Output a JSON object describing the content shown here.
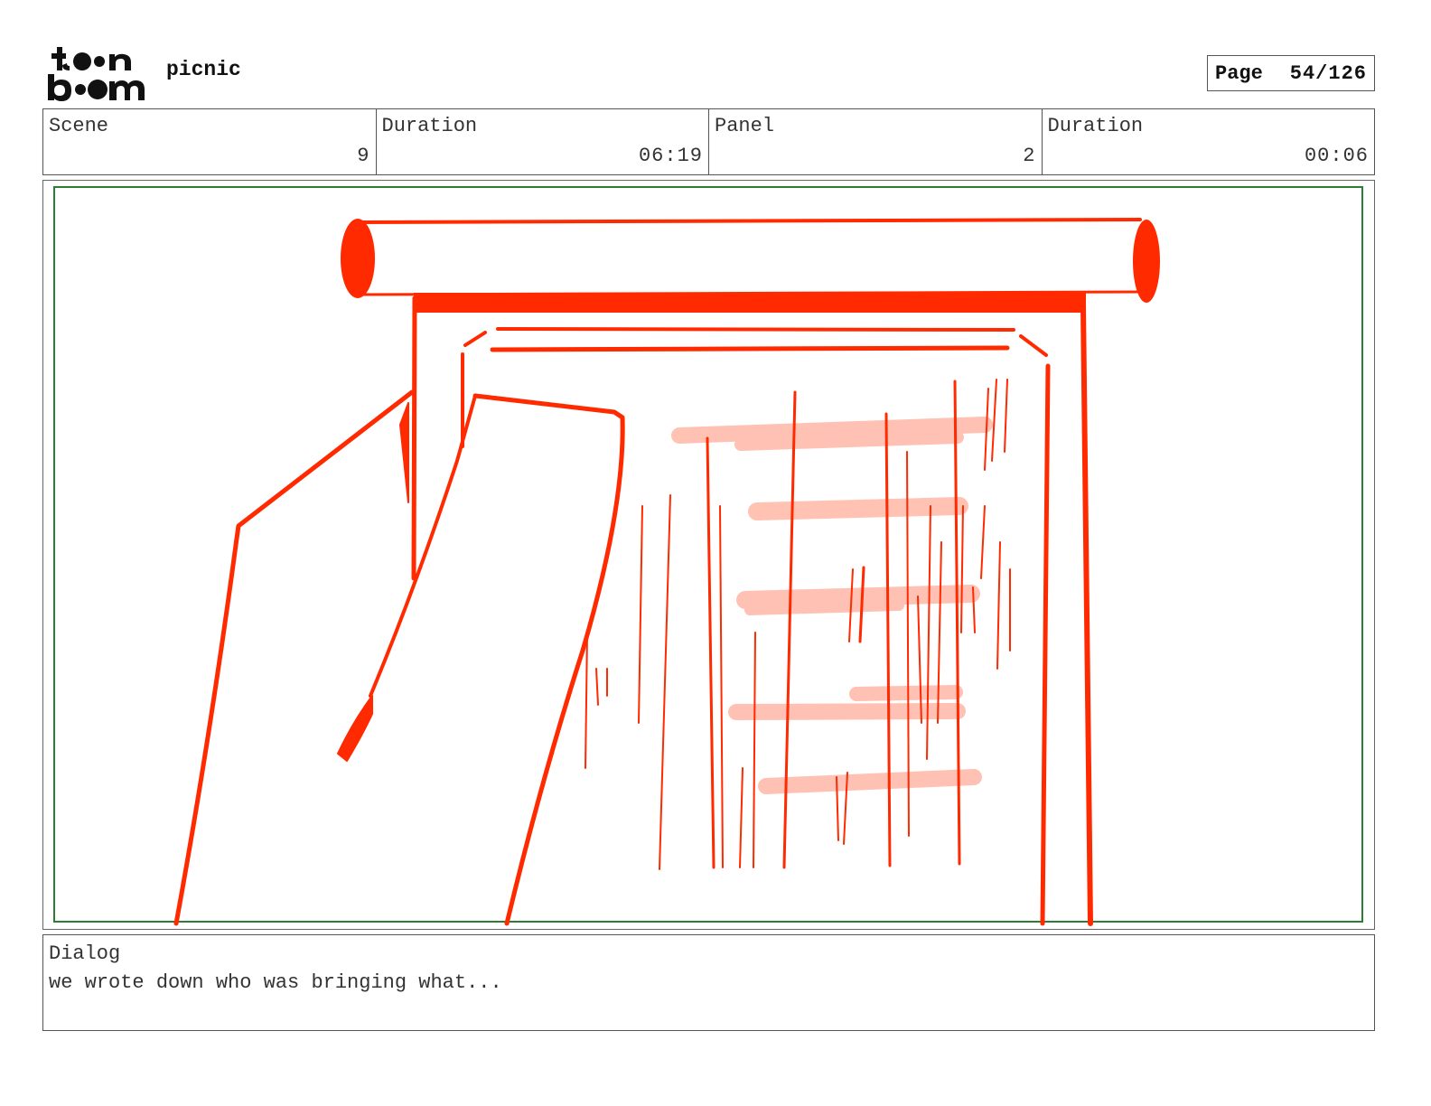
{
  "header": {
    "logo_text": "toonboom",
    "project_title": "picnic",
    "page_label": "Page",
    "page_number": "54/126"
  },
  "info": {
    "scene_label": "Scene",
    "scene_value": "9",
    "scene_duration_label": "Duration",
    "scene_duration_value": "06:19",
    "panel_label": "Panel",
    "panel_value": "2",
    "panel_duration_label": "Duration",
    "panel_duration_value": "00:06"
  },
  "dialog": {
    "label": "Dialog",
    "text": "we wrote down who was bringing what..."
  },
  "colors": {
    "sketch": "#ff2a00",
    "sketch_light": "#ffb7a6",
    "safe_area": "#2e7d32"
  }
}
